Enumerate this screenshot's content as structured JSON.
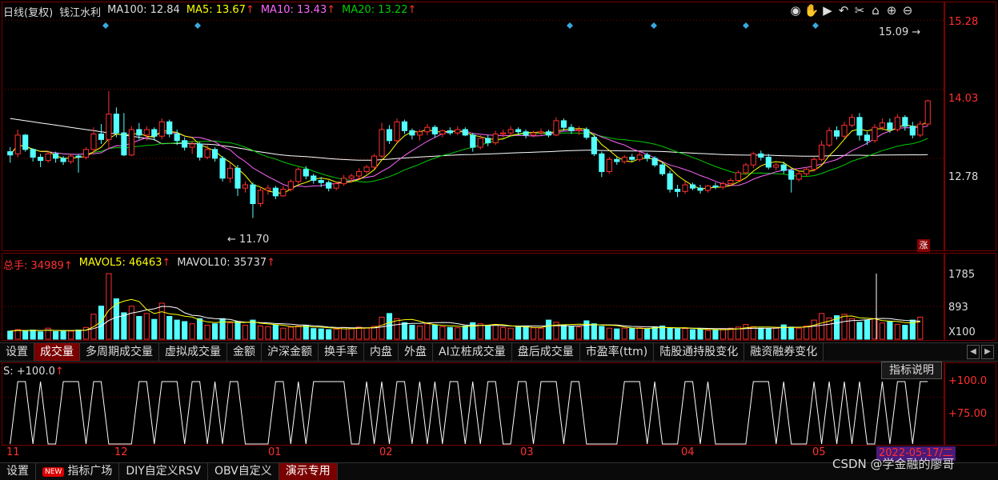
{
  "header": {
    "period_label": "日线(复权)",
    "stock_name": "钱江水利",
    "ma100": "MA100: 12.84",
    "ma5": "MA5: 13.67",
    "ma10": "MA10: 13.43",
    "ma20": "MA20: 13.22",
    "arrow": "↑"
  },
  "toolbar_icons": [
    "eye-icon",
    "hand-icon",
    "play-icon",
    "undo-icon",
    "scissors-icon",
    "lock-icon",
    "zoom-in-icon",
    "zoom-out-icon"
  ],
  "price_axis": {
    "top": "15.28",
    "mid": "14.03",
    "low": "12.78"
  },
  "annotations": {
    "high": "15.09",
    "low": "11.70",
    "rise_badge": "涨"
  },
  "volume_header": {
    "total_label": "总手:",
    "total_value": "34989",
    "mavol5_label": "MAVOL5:",
    "mavol5_value": "46463",
    "mavol10_label": "MAVOL10:",
    "mavol10_value": "35737",
    "arrow": "↑"
  },
  "volume_axis": {
    "top": "1785",
    "mid": "893",
    "unit": "X100"
  },
  "tabs": [
    "设置",
    "成交量",
    "多周期成交量",
    "虚拟成交量",
    "金额",
    "沪深金额",
    "换手率",
    "内盘",
    "外盘",
    "AI立桩成交量",
    "盘后成交量",
    "市盈率(ttm)",
    "陆股通持股变化",
    "融资融券变化"
  ],
  "active_tab": "成交量",
  "s_indicator": {
    "label": "S: +100.0",
    "arrow": "↑",
    "help_button": "指标说明"
  },
  "s_axis": {
    "top": "+100.0",
    "mid": "+75.00"
  },
  "time_axis": [
    "11",
    "12",
    "01",
    "02",
    "03",
    "04",
    "05"
  ],
  "cursor_date": "2022-05-17/二",
  "bottom_tabs": [
    "设置",
    "指标广场",
    "DIY自定义RSV",
    "OBV自定义",
    "演示专用"
  ],
  "new_badge": "NEW",
  "watermark": "CSDN @学金融的廖哥",
  "colors": {
    "up": "#ff3030",
    "down": "#54ffff",
    "ma5": "#ffff00",
    "ma10": "#ff66ff",
    "ma20": "#00cc00",
    "ma100": "#ffffff",
    "grid": "#7a0000"
  },
  "chart_data": {
    "type": "candlestick",
    "price_ylim": [
      11.2,
      15.5
    ],
    "volume_ylim": [
      0,
      1785
    ],
    "ohlc": [
      [
        12.9,
        12.98,
        12.7,
        12.84
      ],
      [
        12.86,
        13.3,
        12.8,
        13.2
      ],
      [
        13.2,
        13.22,
        12.9,
        12.94
      ],
      [
        12.94,
        12.96,
        12.72,
        12.8
      ],
      [
        12.8,
        12.86,
        12.62,
        12.74
      ],
      [
        12.74,
        12.92,
        12.7,
        12.86
      ],
      [
        12.86,
        12.9,
        12.7,
        12.78
      ],
      [
        12.78,
        12.82,
        12.66,
        12.72
      ],
      [
        12.72,
        12.86,
        12.68,
        12.82
      ],
      [
        12.82,
        12.86,
        12.52,
        12.8
      ],
      [
        12.8,
        12.98,
        12.76,
        12.94
      ],
      [
        12.94,
        13.34,
        12.86,
        13.22
      ],
      [
        13.22,
        13.4,
        13.04,
        13.12
      ],
      [
        13.12,
        14.0,
        12.96,
        13.58
      ],
      [
        13.58,
        13.7,
        13.16,
        13.24
      ],
      [
        13.24,
        13.6,
        12.82,
        12.84
      ],
      [
        12.84,
        13.36,
        12.82,
        13.3
      ],
      [
        13.3,
        13.42,
        13.12,
        13.2
      ],
      [
        13.2,
        13.36,
        13.1,
        13.3
      ],
      [
        13.3,
        13.34,
        13.1,
        13.18
      ],
      [
        13.18,
        13.5,
        13.12,
        13.44
      ],
      [
        13.44,
        13.48,
        13.16,
        13.22
      ],
      [
        13.22,
        13.3,
        13.02,
        13.1
      ],
      [
        13.1,
        13.16,
        12.92,
        12.98
      ],
      [
        12.98,
        13.1,
        12.86,
        13.04
      ],
      [
        13.04,
        13.08,
        12.74,
        12.8
      ],
      [
        12.8,
        13.02,
        12.76,
        12.94
      ],
      [
        12.94,
        12.98,
        12.72,
        12.78
      ],
      [
        12.78,
        12.82,
        12.36,
        12.42
      ],
      [
        12.42,
        12.7,
        12.34,
        12.6
      ],
      [
        12.6,
        12.66,
        12.1,
        12.24
      ],
      [
        12.24,
        12.36,
        12.16,
        12.3
      ],
      [
        12.3,
        12.34,
        11.7,
        11.96
      ],
      [
        11.96,
        12.26,
        11.9,
        12.2
      ],
      [
        12.2,
        12.3,
        12.12,
        12.24
      ],
      [
        12.24,
        12.28,
        12.04,
        12.1
      ],
      [
        12.1,
        12.28,
        12.08,
        12.22
      ],
      [
        12.22,
        12.4,
        12.18,
        12.36
      ],
      [
        12.36,
        12.62,
        12.32,
        12.58
      ],
      [
        12.58,
        12.64,
        12.4,
        12.46
      ],
      [
        12.46,
        12.5,
        12.32,
        12.38
      ],
      [
        12.38,
        12.44,
        12.26,
        12.34
      ],
      [
        12.34,
        12.38,
        12.18,
        12.24
      ],
      [
        12.24,
        12.36,
        12.2,
        12.32
      ],
      [
        12.32,
        12.48,
        12.28,
        12.42
      ],
      [
        12.42,
        12.5,
        12.34,
        12.46
      ],
      [
        12.46,
        12.6,
        12.4,
        12.54
      ],
      [
        12.54,
        12.66,
        12.5,
        12.62
      ],
      [
        12.62,
        12.86,
        12.58,
        12.82
      ],
      [
        12.82,
        13.42,
        12.78,
        13.3
      ],
      [
        13.3,
        13.38,
        13.04,
        13.1
      ],
      [
        13.1,
        13.5,
        13.06,
        13.44
      ],
      [
        13.44,
        13.48,
        13.22,
        13.28
      ],
      [
        13.28,
        13.32,
        13.12,
        13.2
      ],
      [
        13.2,
        13.3,
        13.1,
        13.26
      ],
      [
        13.26,
        13.4,
        13.2,
        13.34
      ],
      [
        13.34,
        13.38,
        13.16,
        13.22
      ],
      [
        13.22,
        13.3,
        13.16,
        13.28
      ],
      [
        13.28,
        13.34,
        13.2,
        13.24
      ],
      [
        13.24,
        13.36,
        13.2,
        13.3
      ],
      [
        13.3,
        13.34,
        13.18,
        13.2
      ],
      [
        13.2,
        13.24,
        12.9,
        12.98
      ],
      [
        12.98,
        13.2,
        12.94,
        13.14
      ],
      [
        13.14,
        13.2,
        13.0,
        13.06
      ],
      [
        13.06,
        13.28,
        13.02,
        13.22
      ],
      [
        13.22,
        13.3,
        13.16,
        13.24
      ],
      [
        13.24,
        13.36,
        13.18,
        13.3
      ],
      [
        13.3,
        13.34,
        13.2,
        13.26
      ],
      [
        13.26,
        13.3,
        13.14,
        13.2
      ],
      [
        13.2,
        13.28,
        13.16,
        13.24
      ],
      [
        13.24,
        13.32,
        13.2,
        13.26
      ],
      [
        13.26,
        13.3,
        13.16,
        13.2
      ],
      [
        13.2,
        13.52,
        13.18,
        13.46
      ],
      [
        13.46,
        13.5,
        13.28,
        13.34
      ],
      [
        13.34,
        13.4,
        13.22,
        13.28
      ],
      [
        13.28,
        13.36,
        13.2,
        13.3
      ],
      [
        13.3,
        13.34,
        13.12,
        13.16
      ],
      [
        13.16,
        13.2,
        12.82,
        12.86
      ],
      [
        12.86,
        12.9,
        12.44,
        12.54
      ],
      [
        12.54,
        12.8,
        12.5,
        12.76
      ],
      [
        12.76,
        12.8,
        12.66,
        12.72
      ],
      [
        12.72,
        12.84,
        12.68,
        12.8
      ],
      [
        12.8,
        12.86,
        12.72,
        12.76
      ],
      [
        12.76,
        12.9,
        12.72,
        12.84
      ],
      [
        12.84,
        12.88,
        12.72,
        12.78
      ],
      [
        12.78,
        12.82,
        12.62,
        12.66
      ],
      [
        12.66,
        12.72,
        12.46,
        12.5
      ],
      [
        12.5,
        12.56,
        12.16,
        12.22
      ],
      [
        12.22,
        12.3,
        12.08,
        12.18
      ],
      [
        12.18,
        12.36,
        12.14,
        12.3
      ],
      [
        12.3,
        12.34,
        12.2,
        12.24
      ],
      [
        12.24,
        12.3,
        12.14,
        12.2
      ],
      [
        12.2,
        12.3,
        12.16,
        12.28
      ],
      [
        12.28,
        12.34,
        12.22,
        12.26
      ],
      [
        12.26,
        12.36,
        12.22,
        12.32
      ],
      [
        12.32,
        12.42,
        12.28,
        12.38
      ],
      [
        12.38,
        12.56,
        12.34,
        12.52
      ],
      [
        12.52,
        12.7,
        12.48,
        12.66
      ],
      [
        12.66,
        12.9,
        12.6,
        12.86
      ],
      [
        12.86,
        12.92,
        12.74,
        12.8
      ],
      [
        12.8,
        12.86,
        12.58,
        12.62
      ],
      [
        12.62,
        12.7,
        12.56,
        12.66
      ],
      [
        12.66,
        12.72,
        12.5,
        12.56
      ],
      [
        12.56,
        12.6,
        12.16,
        12.4
      ],
      [
        12.4,
        12.56,
        12.36,
        12.5
      ],
      [
        12.5,
        12.62,
        12.46,
        12.58
      ],
      [
        12.58,
        12.8,
        12.54,
        12.76
      ],
      [
        12.76,
        13.1,
        12.72,
        13.02
      ],
      [
        13.02,
        13.34,
        12.98,
        13.28
      ],
      [
        13.28,
        13.36,
        13.12,
        13.18
      ],
      [
        13.18,
        13.44,
        13.14,
        13.38
      ],
      [
        13.38,
        13.58,
        13.34,
        13.52
      ],
      [
        13.52,
        13.6,
        13.1,
        13.2
      ],
      [
        13.2,
        13.26,
        13.02,
        13.1
      ],
      [
        13.1,
        13.4,
        13.06,
        13.34
      ],
      [
        13.34,
        13.5,
        13.28,
        13.42
      ],
      [
        13.42,
        13.5,
        13.24,
        13.3
      ],
      [
        13.3,
        13.58,
        13.26,
        13.52
      ],
      [
        13.52,
        13.56,
        13.28,
        13.36
      ],
      [
        13.36,
        13.44,
        13.14,
        13.2
      ],
      [
        13.2,
        13.46,
        13.16,
        13.4
      ],
      [
        13.4,
        13.84,
        13.36,
        13.82
      ]
    ],
    "volumes": [
      220,
      260,
      230,
      250,
      200,
      300,
      210,
      230,
      220,
      250,
      320,
      680,
      900,
      1785,
      1100,
      720,
      900,
      620,
      700,
      540,
      980,
      620,
      520,
      480,
      420,
      560,
      380,
      420,
      560,
      440,
      480,
      380,
      520,
      360,
      340,
      380,
      300,
      330,
      360,
      380,
      290,
      280,
      260,
      270,
      320,
      300,
      330,
      300,
      350,
      600,
      700,
      560,
      450,
      380,
      360,
      420,
      380,
      340,
      320,
      310,
      360,
      450,
      420,
      380,
      400,
      320,
      300,
      330,
      350,
      310,
      300,
      520,
      460,
      380,
      340,
      330,
      500,
      420,
      350,
      300,
      280,
      300,
      290,
      310,
      280,
      340,
      360,
      300,
      280,
      290,
      260,
      270,
      240,
      260,
      270,
      300,
      330,
      400,
      340,
      300,
      280,
      300,
      390,
      330,
      300,
      360,
      520,
      700,
      580,
      640,
      680,
      560,
      460,
      520,
      560,
      440,
      480,
      400,
      380,
      520,
      600
    ]
  }
}
